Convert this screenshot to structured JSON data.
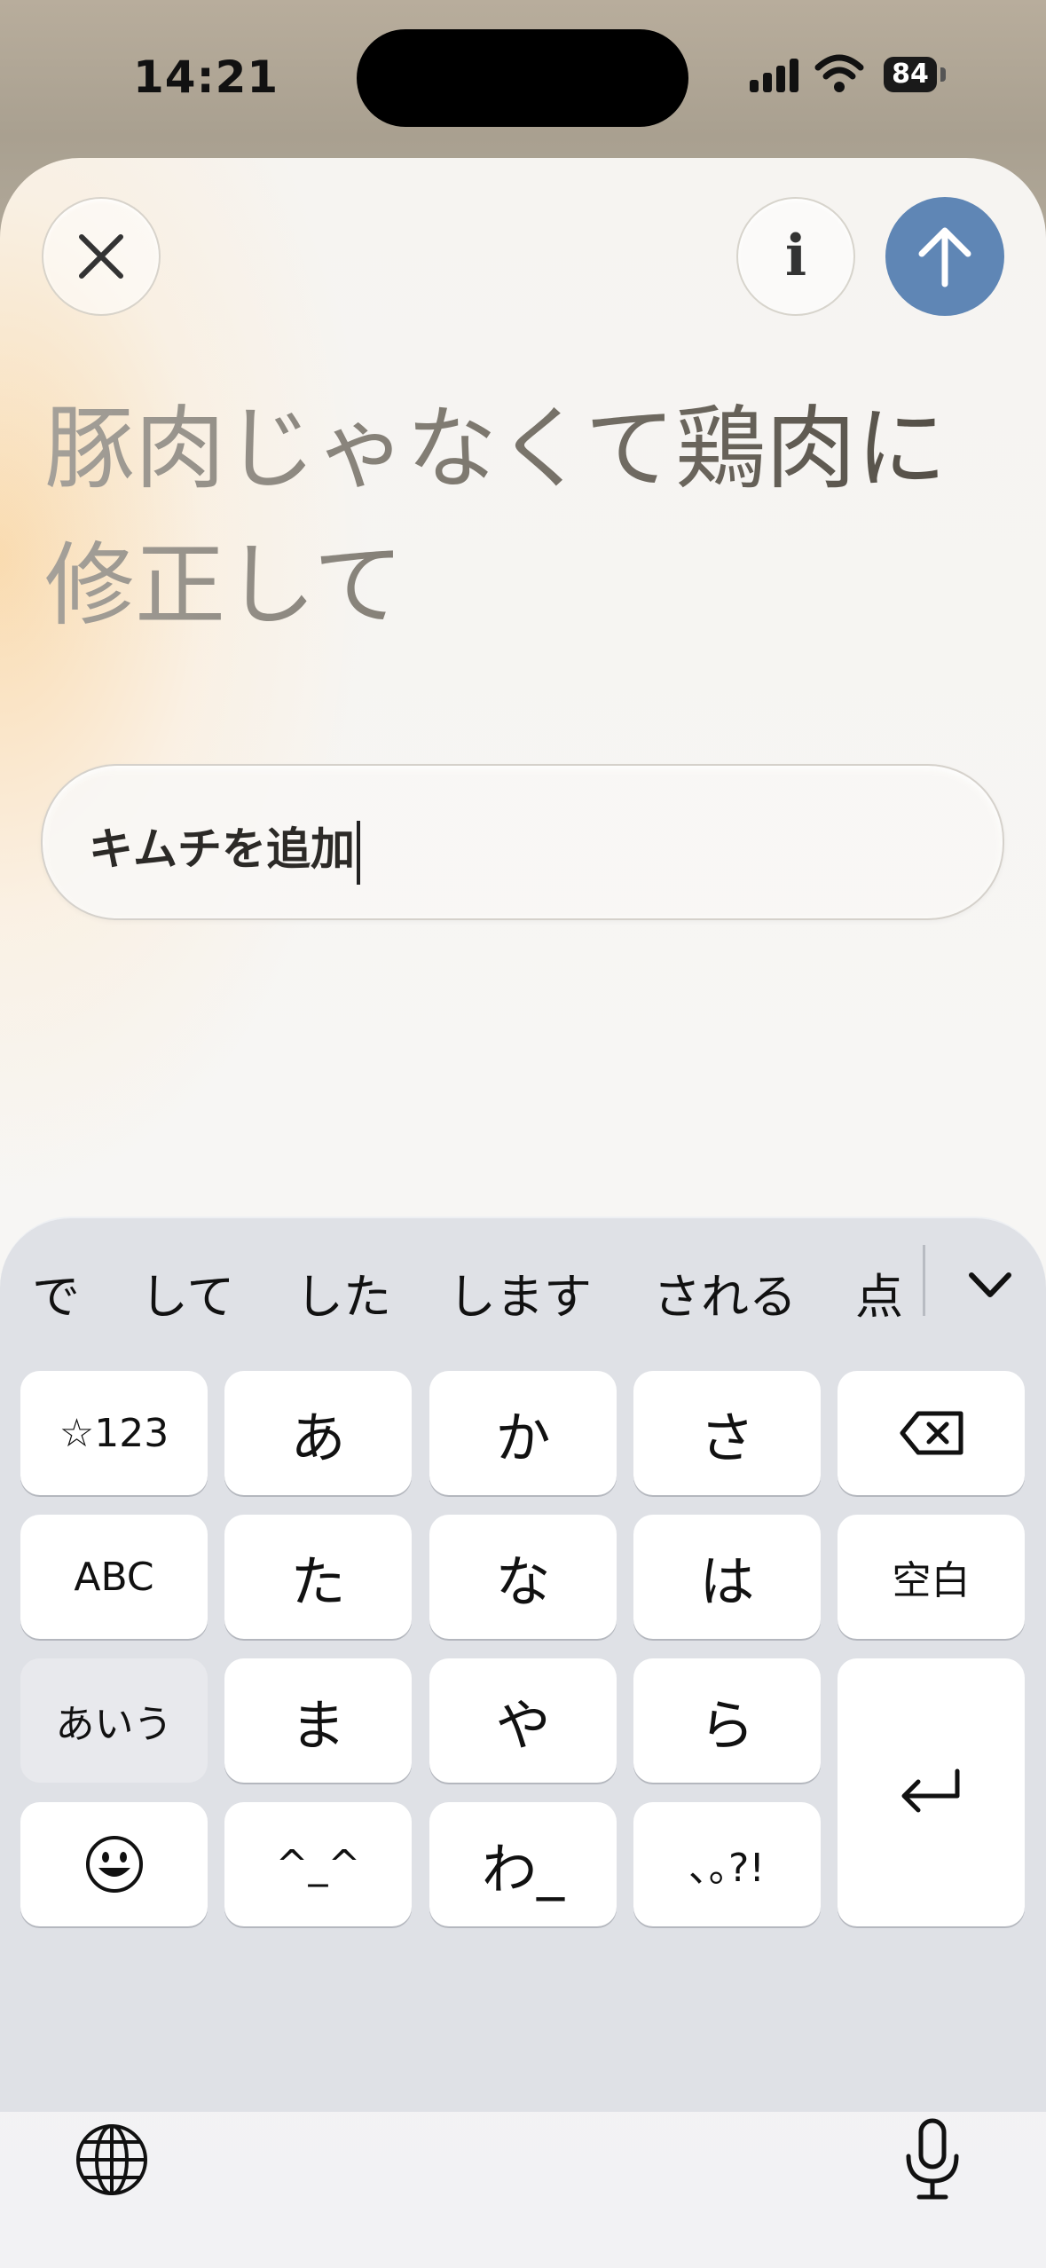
{
  "status": {
    "time": "14:21",
    "battery": "84"
  },
  "header": {
    "close_icon": "close-icon",
    "info_label": "i",
    "send_icon": "arrow-up-icon"
  },
  "previous_prompt": "豚肉じゃなくて鶏肉に修正して",
  "input": {
    "value": "キムチを追加"
  },
  "keyboard": {
    "candidates": [
      "で",
      "して",
      "した",
      "します",
      "される",
      "点"
    ],
    "rows": {
      "r1": [
        "☆123",
        "あ",
        "か",
        "さ"
      ],
      "r2": [
        "ABC",
        "た",
        "な",
        "は",
        "空白"
      ],
      "r3": [
        "あいう",
        "ま",
        "や",
        "ら"
      ],
      "r4": [
        "^_^",
        "わ_",
        "､｡?!"
      ]
    },
    "icons": {
      "delete": "delete-icon",
      "emoji": "emoji-icon",
      "return": "return-icon",
      "globe": "globe-icon",
      "mic": "microphone-icon",
      "expand": "chevron-down-icon"
    }
  },
  "colors": {
    "send_button": "#5f86b5",
    "keyboard_bg": "#dfe1e6"
  }
}
